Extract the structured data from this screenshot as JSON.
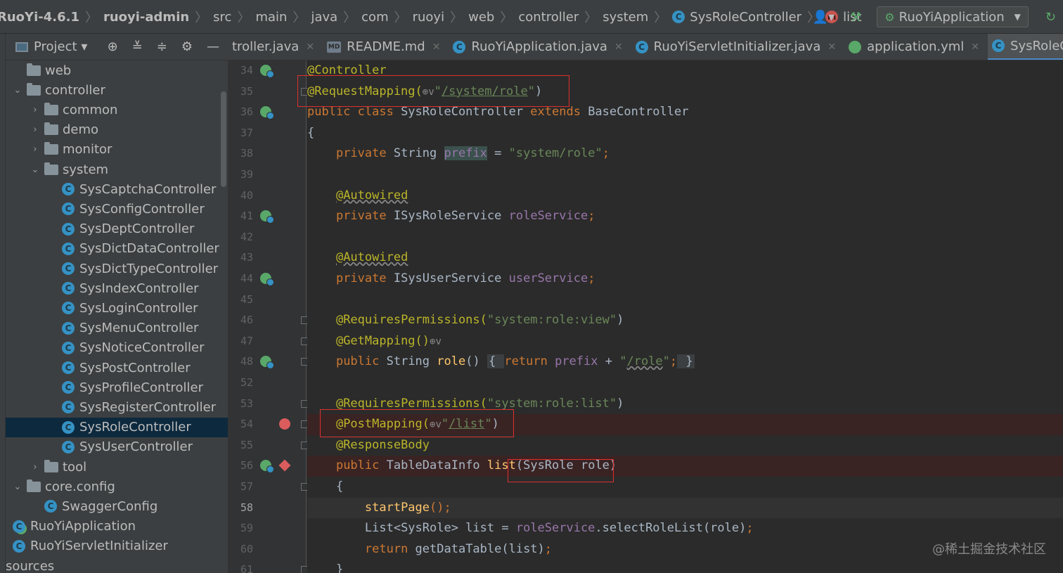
{
  "breadcrumbs": [
    "RuoYi-4.6.1",
    "ruoyi-admin",
    "src",
    "main",
    "java",
    "com",
    "ruoyi",
    "web",
    "controller",
    "system",
    "SysRoleController",
    "list"
  ],
  "toolbar": {
    "user_icon": "user-icon",
    "build_icon": "hammer-icon",
    "run_config": "RuoYiApplication",
    "update_icon": "update-icon"
  },
  "project_panel": {
    "title": "Project",
    "tools": [
      "target-icon",
      "expand-all-icon",
      "collapse-all-icon",
      "gear-icon",
      "minimize-icon"
    ]
  },
  "tree": [
    {
      "label": "web",
      "type": "folder",
      "indent": 0,
      "expanded": null
    },
    {
      "label": "controller",
      "type": "folder",
      "indent": 0,
      "expanded": true
    },
    {
      "label": "common",
      "type": "folder",
      "indent": 1,
      "expanded": false
    },
    {
      "label": "demo",
      "type": "folder",
      "indent": 1,
      "expanded": false
    },
    {
      "label": "monitor",
      "type": "folder",
      "indent": 1,
      "expanded": false
    },
    {
      "label": "system",
      "type": "folder",
      "indent": 1,
      "expanded": true
    },
    {
      "label": "SysCaptchaController",
      "type": "class",
      "indent": 2
    },
    {
      "label": "SysConfigController",
      "type": "class",
      "indent": 2
    },
    {
      "label": "SysDeptController",
      "type": "class",
      "indent": 2
    },
    {
      "label": "SysDictDataController",
      "type": "class",
      "indent": 2
    },
    {
      "label": "SysDictTypeController",
      "type": "class",
      "indent": 2
    },
    {
      "label": "SysIndexController",
      "type": "class",
      "indent": 2
    },
    {
      "label": "SysLoginController",
      "type": "class",
      "indent": 2
    },
    {
      "label": "SysMenuController",
      "type": "class",
      "indent": 2
    },
    {
      "label": "SysNoticeController",
      "type": "class",
      "indent": 2
    },
    {
      "label": "SysPostController",
      "type": "class",
      "indent": 2
    },
    {
      "label": "SysProfileController",
      "type": "class",
      "indent": 2
    },
    {
      "label": "SysRegisterController",
      "type": "class",
      "indent": 2
    },
    {
      "label": "SysRoleController",
      "type": "class",
      "indent": 2,
      "selected": true
    },
    {
      "label": "SysUserController",
      "type": "class",
      "indent": 2
    },
    {
      "label": "tool",
      "type": "folder",
      "indent": 1,
      "expanded": false
    },
    {
      "label": "core.config",
      "type": "folder",
      "indent": 0,
      "expanded": true
    },
    {
      "label": "SwaggerConfig",
      "type": "class",
      "indent": 1
    },
    {
      "label": "RuoYiApplication",
      "type": "app",
      "indent": -1
    },
    {
      "label": "RuoYiServletInitializer",
      "type": "class",
      "indent": -1
    },
    {
      "label": "sources",
      "type": "plain",
      "indent": -2
    }
  ],
  "tabs": [
    {
      "label": "troller.java",
      "icon": "none"
    },
    {
      "label": "README.md",
      "icon": "md"
    },
    {
      "label": "RuoYiApplication.java",
      "icon": "app"
    },
    {
      "label": "RuoYiServletInitializer.java",
      "icon": "class"
    },
    {
      "label": "application.yml",
      "icon": "yml"
    },
    {
      "label": "SysRoleControlle",
      "icon": "class",
      "active": true
    }
  ],
  "code_lines": [
    {
      "num": "34",
      "spring": true
    },
    {
      "num": "35"
    },
    {
      "num": "36",
      "spring": true
    },
    {
      "num": "37"
    },
    {
      "num": "38"
    },
    {
      "num": "39"
    },
    {
      "num": "40"
    },
    {
      "num": "41",
      "spring": true
    },
    {
      "num": "42"
    },
    {
      "num": "43"
    },
    {
      "num": "44",
      "spring": true
    },
    {
      "num": "45"
    },
    {
      "num": "46"
    },
    {
      "num": "47"
    },
    {
      "num": "48",
      "spring": true
    },
    {
      "num": "52"
    },
    {
      "num": "53"
    },
    {
      "num": "54",
      "breakpoint": true
    },
    {
      "num": "55"
    },
    {
      "num": "56",
      "spring": true,
      "diamond": true
    },
    {
      "num": "57"
    },
    {
      "num": "58",
      "current": true
    },
    {
      "num": "59"
    },
    {
      "num": "60"
    },
    {
      "num": "61"
    }
  ],
  "code": {
    "l34_ann": "@Controller",
    "l35_ann": "@RequestMapping(",
    "l35_path": "/system/role",
    "l35_end": "\")",
    "l36_kw1": "public class ",
    "l36_cls": "SysRoleController ",
    "l36_kw2": "extends ",
    "l36_base": "BaseController",
    "l37": "{",
    "l38_kw": "private ",
    "l38_type": "String ",
    "l38_fld": "prefix",
    "l38_eq": " = ",
    "l38_str": "\"system/role\"",
    "l38_semi": ";",
    "l40_ann": "@Autowired",
    "l41_kw": "private ",
    "l41_type": "ISysRoleService ",
    "l41_fld": "roleService",
    "l41_semi": ";",
    "l43_ann": "@Autowired",
    "l44_kw": "private ",
    "l44_type": "ISysUserService ",
    "l44_fld": "userService",
    "l44_semi": ";",
    "l46_ann": "@RequiresPermissions(",
    "l46_str": "\"system:role:view\"",
    "l46_end": ")",
    "l47_ann": "@GetMapping()",
    "l48_kw": "public ",
    "l48_type": "String ",
    "l48_fn": "role",
    "l48_paren": "() ",
    "l48_open": "{ ",
    "l48_ret": "return ",
    "l48_fld": "prefix",
    "l48_plus": " + ",
    "l48_str_q": "\"",
    "l48_str_p": "/role",
    "l48_str_end": "\"",
    "l48_semi": ";",
    "l48_close": " }",
    "l53_ann": "@RequiresPermissions(",
    "l53_str": "\"system:role:list\"",
    "l53_end": ")",
    "l54_ann": "@PostMapping(",
    "l54_path": "/list",
    "l54_end": "\")",
    "l55_ann": "@ResponseBody",
    "l56_kw": "public ",
    "l56_type": "TableDataInfo ",
    "l56_fn": "list",
    "l56_args": "(SysRole role)",
    "l57": "{",
    "l58_fn": "startPage",
    "l58_end": "();",
    "l59_type": "List<SysRole> list = ",
    "l59_fld": "roleService",
    "l59_call": ".selectRoleList(role)",
    "l59_semi": ";",
    "l60_kw": "return ",
    "l60_call": "getDataTable(list)",
    "l60_semi": ";",
    "l61": "}"
  },
  "watermark": "@稀土掘金技术社区",
  "colors": {
    "annotation": "#bbb529",
    "keyword": "#cc7832",
    "string": "#6a8759",
    "field": "#9876aa",
    "function": "#ffc66d",
    "highlight_box": "#e03030"
  }
}
